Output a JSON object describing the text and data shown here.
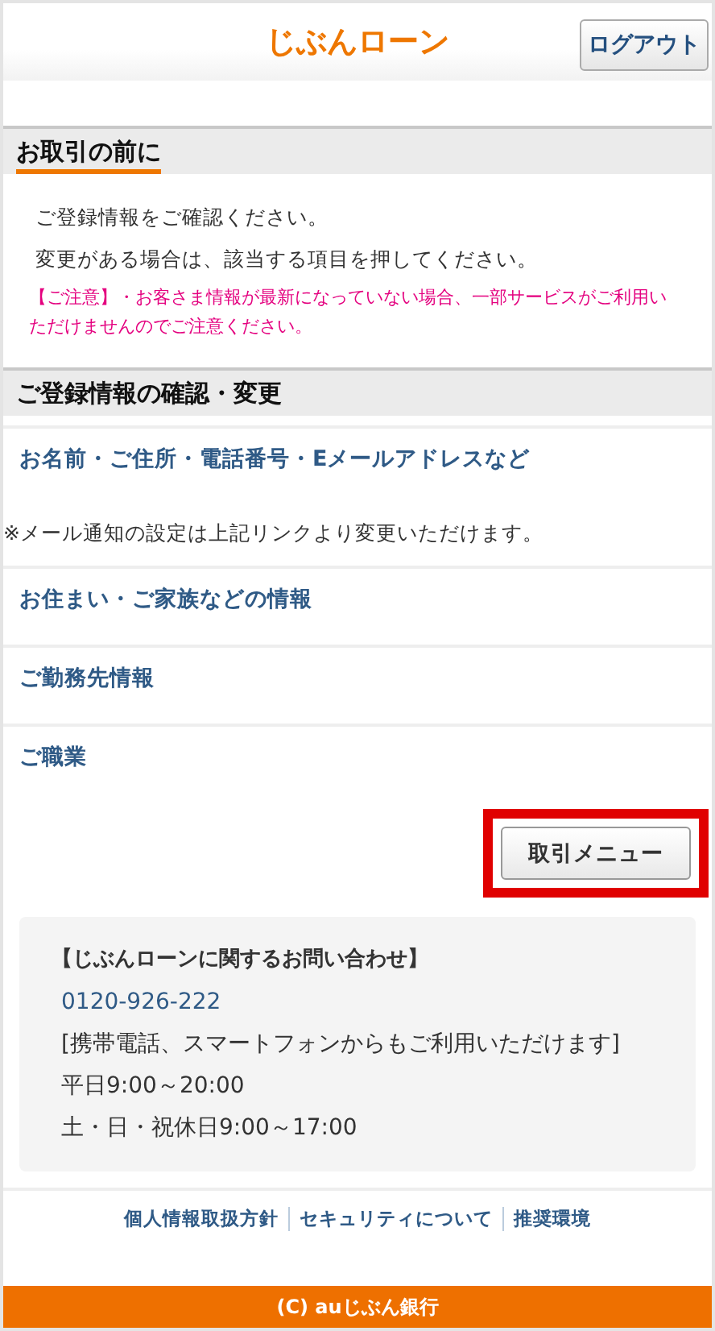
{
  "header": {
    "logo": "じぶんローン",
    "logout_button": "ログアウト"
  },
  "intro": {
    "title": "お取引の前に",
    "lines": [
      "ご登録情報をご確認ください。",
      "変更がある場合は、該当する項目を押してください。"
    ],
    "notice": "【ご注意】・お客さま情報が最新になっていない場合、一部サービスがご利用いただけませんのでご注意ください。"
  },
  "registration": {
    "title": "ご登録情報の確認・変更",
    "items": [
      {
        "kind": "link",
        "text": "お名前・ご住所・電話番号・Eメールアドレスなど"
      },
      {
        "kind": "note",
        "text": "※メール通知の設定は上記リンクより変更いただけます。"
      },
      {
        "kind": "link",
        "text": "お住まい・ご家族などの情報"
      },
      {
        "kind": "link",
        "text": "ご勤務先情報"
      },
      {
        "kind": "link",
        "text": "ご職業"
      }
    ]
  },
  "menu_button": {
    "label": "取引メニュー",
    "highlighted": true
  },
  "contact": {
    "title": "【じぶんローンに関するお問い合わせ】",
    "phone": "0120-926-222",
    "lines": [
      "[携帯電話、スマートフォンからもご利用いただけます]",
      "平日9:00～20:00",
      "土・日・祝休日9:00～17:00"
    ]
  },
  "footer": {
    "links": [
      "個人情報取扱方針",
      "セキュリティについて",
      "推奨環境"
    ],
    "copyright": "(C) auじぶん銀行"
  }
}
